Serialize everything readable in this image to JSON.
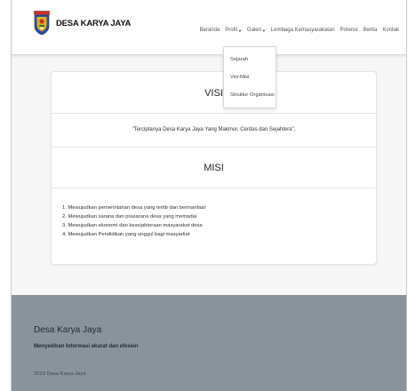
{
  "brand": {
    "name": "DESA KARYA JAYA"
  },
  "nav": {
    "items": [
      {
        "label": "Beranda",
        "caret": false
      },
      {
        "label": "Profil",
        "caret": true
      },
      {
        "label": "Galeri",
        "caret": true
      },
      {
        "label": "Lembaga Kemasyarakatan",
        "caret": false
      },
      {
        "label": "Potensi",
        "caret": false
      },
      {
        "label": "Berita",
        "caret": false
      },
      {
        "label": "Kontak",
        "caret": false
      }
    ],
    "caret_glyph": "▼"
  },
  "dropdown": {
    "items": [
      "Sejarah",
      "Visi-Misi",
      "Struktur Organisasi"
    ]
  },
  "visi": {
    "title": "VISI",
    "text": "\"Terciptanya Desa Karya Jaya Yang Makmur, Cerdas dan Sejahtera\","
  },
  "misi": {
    "title": "MISI",
    "items": [
      "1. Mewujudkan pemerintahan desa yang tertib dan bermanfaat",
      "2. Mewujudkan sarana dan prasarana desa yang memadai",
      "3. Mewujudkan ekonomi dan kesejahteraan masyarakat desa",
      "4. Mewujudkan Pendidikan yang unggul bagi masyarkat"
    ]
  },
  "footer": {
    "title": "Desa Karya Jaya",
    "tagline": "Menyedikan Informasi akurat dan efesien",
    "copyright": "2023 Desa Karya Jaya"
  },
  "colors": {
    "footer_bg": "#8a939a",
    "logo_blue": "#2b4fa0",
    "logo_gold": "#e3b11f",
    "logo_red": "#c8332a"
  }
}
